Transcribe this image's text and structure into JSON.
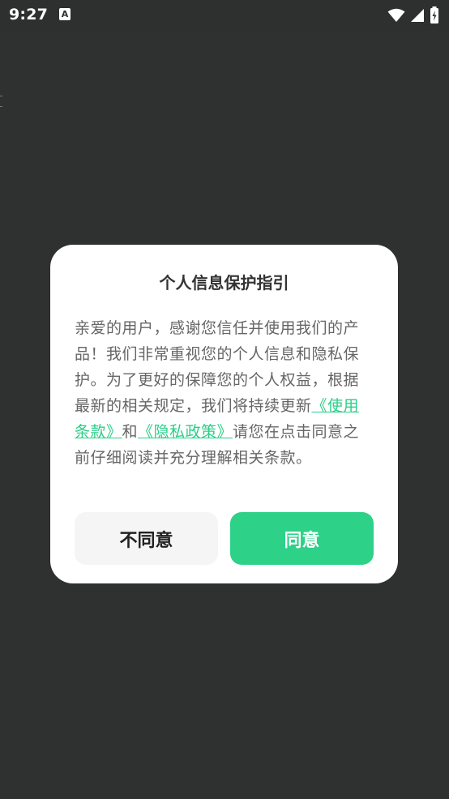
{
  "status_bar": {
    "time": "9:27",
    "notification_icon": "a-notification-icon",
    "wifi_icon": "wifi-icon",
    "signal_icon": "cellular-signal-icon",
    "battery_icon": "battery-charging-icon"
  },
  "dialog": {
    "title": "个人信息保护指引",
    "body_before_terms": "亲爱的用户，感谢您信任并使用我们的产品！我们非常重视您的个人信息和隐私保护。为了更好的保障您的个人权益，根据最新的相关规定，我们将持续更新",
    "terms_link": "《使用条款》",
    "body_and": "和",
    "privacy_link": "《隐私政策》",
    "body_after_privacy": "请您在点击同意之前仔细阅读并充分理解相关条款。",
    "disagree_label": "不同意",
    "agree_label": "同意"
  },
  "colors": {
    "accent": "#2dd188",
    "link": "#2bce87",
    "background": "#2f3030"
  }
}
